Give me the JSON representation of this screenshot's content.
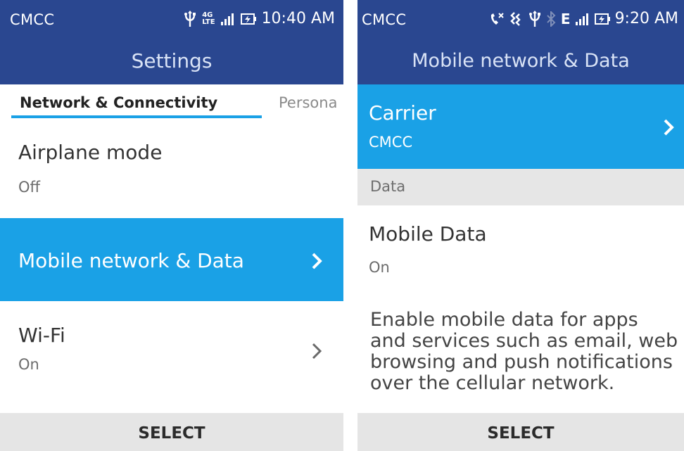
{
  "left_screen": {
    "status": {
      "carrier": "CMCC",
      "network_badge_top": "4G",
      "network_badge_bottom": "LTE",
      "time": "10:40 AM"
    },
    "header_title": "Settings",
    "tabs": {
      "active": "Network & Connectivity",
      "next": "Persona"
    },
    "items": [
      {
        "title": "Airplane mode",
        "subtitle": "Off"
      },
      {
        "title": "Mobile network & Data",
        "selected": true
      },
      {
        "title": "Wi-Fi",
        "subtitle": "On"
      }
    ],
    "softkey": "SELECT"
  },
  "right_screen": {
    "status": {
      "carrier": "CMCC",
      "network_type": "E",
      "time": "9:20 AM"
    },
    "header_title": "Mobile network & Data",
    "carrier_item": {
      "title": "Carrier",
      "value": "CMCC",
      "selected": true
    },
    "section_header": "Data",
    "mobile_data": {
      "title": "Mobile Data",
      "value": "On"
    },
    "description": "Enable mobile data for apps and services such as email, web browsing and push notifications over the cellular network.",
    "softkey": "SELECT"
  },
  "colors": {
    "header": "#2a4790",
    "accent": "#1aa1e6",
    "softkey_bg": "#e5e5e5"
  },
  "icons": [
    "usb-icon",
    "signal-icon",
    "battery-charging-icon",
    "missed-call-icon",
    "roaming-icon",
    "bluetooth-icon"
  ]
}
